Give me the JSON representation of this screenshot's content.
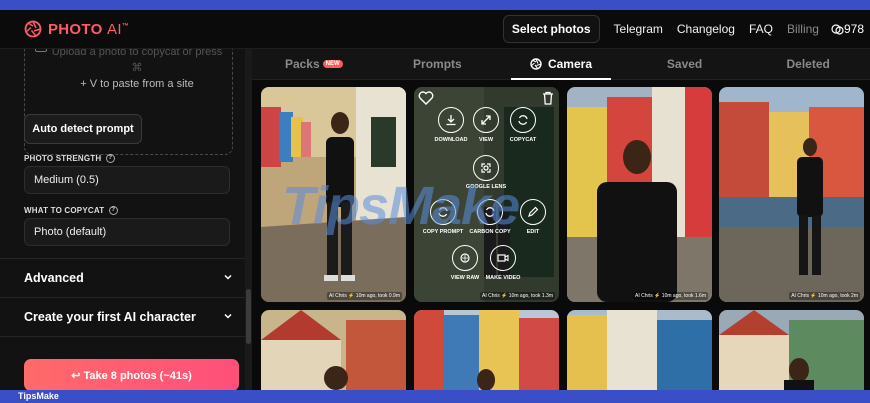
{
  "brand": {
    "name": "PHOTO",
    "suffix": "AI",
    "tm": "™",
    "accent": "#ff5a6a"
  },
  "nav": {
    "select_photos": "Select photos",
    "telegram": "Telegram",
    "changelog": "Changelog",
    "faq": "FAQ",
    "billing": "Billing",
    "credits": "978",
    "credits_icon": "credits-icon"
  },
  "sidebar": {
    "upload_hint_line1": "Upload a photo to copycat or press ⌘",
    "upload_hint_line2": "+ V to paste from a site",
    "auto_detect": "Auto detect prompt",
    "photo_strength_label": "PHOTO STRENGTH",
    "photo_strength_value": "Medium (0.5)",
    "copycat_label": "WHAT TO COPYCAT",
    "copycat_value": "Photo (default)",
    "advanced": "Advanced",
    "create_character": "Create your first AI character",
    "take_button": "↩ Take 8 photos (~41s)"
  },
  "tabs": [
    {
      "label": "Packs",
      "badge": "NEW"
    },
    {
      "label": "Prompts"
    },
    {
      "label": "Camera",
      "active": true
    },
    {
      "label": "Saved"
    },
    {
      "label": "Deleted"
    }
  ],
  "overlay": {
    "download": "DOWNLOAD",
    "view": "VIEW",
    "copycat": "COPYCAT",
    "google_lens": "GOOGLE LENS",
    "copy_prompt": "COPY PROMPT",
    "carbon_copy": "CARBON COPY",
    "edit": "EDIT",
    "view_raw": "VIEW RAW",
    "make_video": "MAKE VIDEO"
  },
  "photos": [
    {
      "caption": "AI Chris ⚡ 10m ago, took 0.9m"
    },
    {
      "caption": "AI Chris ⚡ 10m ago, took 1.3m"
    },
    {
      "caption": "AI Chris ⚡ 10m ago, took 1.6m"
    },
    {
      "caption": "AI Chris ⚡ 10m ago, took 2m"
    }
  ],
  "watermark": "TipsMake",
  "footer": "TipsMake"
}
